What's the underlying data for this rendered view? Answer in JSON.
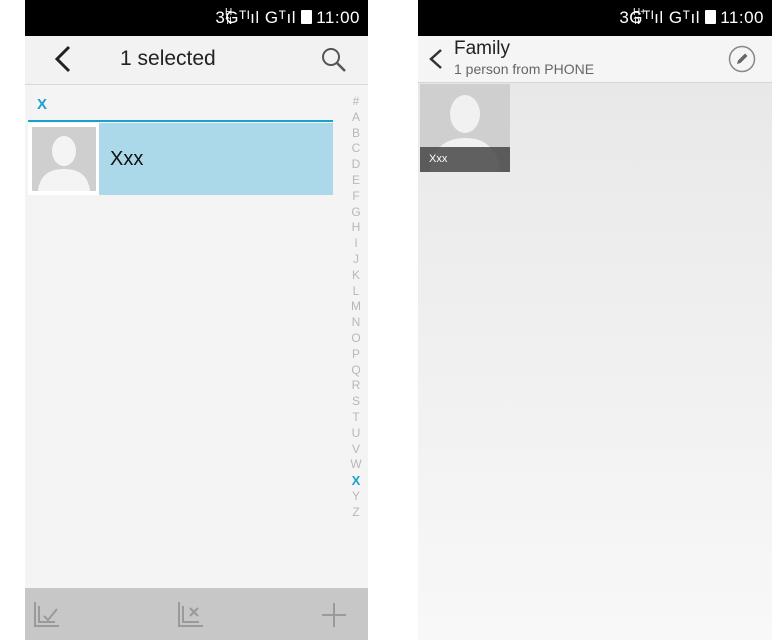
{
  "left_screen": {
    "status": {
      "text": "3Gᵀᵀıl Gᵀıl ▬ 11:00",
      "time": "11:00"
    },
    "header": {
      "title": "1 selected"
    },
    "section_letter": "X",
    "contacts": [
      {
        "name": "Xxx",
        "selected": true
      }
    ],
    "index": [
      "#",
      "A",
      "B",
      "C",
      "D",
      "E",
      "F",
      "G",
      "H",
      "I",
      "J",
      "K",
      "L",
      "M",
      "N",
      "O",
      "P",
      "Q",
      "R",
      "S",
      "T",
      "U",
      "V",
      "W",
      "X",
      "Y",
      "Z"
    ],
    "active_index": "X",
    "toolbar": [
      "select-all-icon",
      "deselect-all-icon",
      "add-icon"
    ]
  },
  "right_screen": {
    "status": {
      "time": "11:00"
    },
    "header": {
      "title": "Family",
      "subtitle": "1 person from PHONE"
    },
    "members": [
      {
        "name": "Xxx"
      }
    ]
  },
  "colors": {
    "accent": "#1b9fd0",
    "selected_row": "#abd9e9",
    "toolbar": "#c7c7c7"
  }
}
